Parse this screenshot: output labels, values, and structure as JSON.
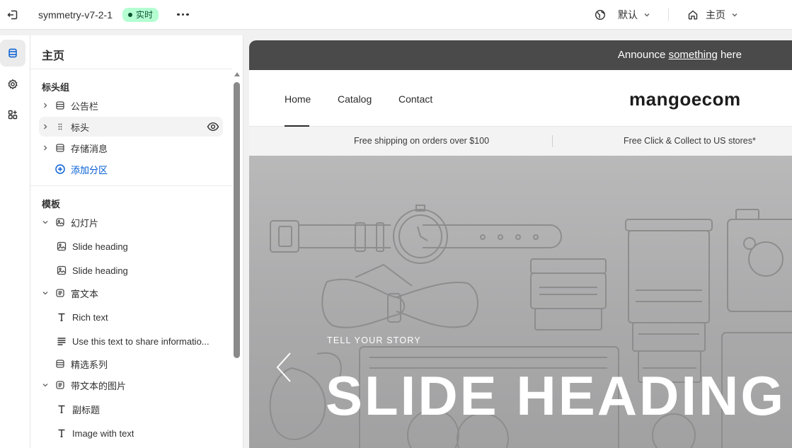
{
  "topbar": {
    "theme_name": "symmetry-v7-2-1",
    "status": "实时",
    "locale": "默认",
    "page": "主页"
  },
  "sidebar": {
    "title": "主页",
    "header_group": {
      "title": "标头组",
      "items": [
        {
          "label": "公告栏",
          "icon": "section-icon"
        },
        {
          "label": "标头",
          "icon": "drag-handle-icon"
        },
        {
          "label": "存储消息",
          "icon": "section-icon"
        }
      ],
      "add_section": "添加分区"
    },
    "template": {
      "title": "模板",
      "slideshow": {
        "label": "幻灯片",
        "blocks": [
          "Slide heading",
          "Slide heading"
        ]
      },
      "rich_text": {
        "label": "富文本",
        "blocks": [
          "Rich text",
          "Use this text to share informatio..."
        ]
      },
      "featured_collection": {
        "label": "精选系列"
      },
      "image_with_text": {
        "label": "带文本的图片",
        "blocks": [
          "副标题",
          "Image with text"
        ]
      }
    }
  },
  "preview": {
    "announcement": {
      "before": "Announce ",
      "link": "something",
      "after": " here"
    },
    "nav": [
      "Home",
      "Catalog",
      "Contact"
    ],
    "logo": "mangoecom",
    "shipping": [
      "Free shipping on orders over $100",
      "Free Click & Collect to US stores*"
    ],
    "hero": {
      "kicker": "TELL YOUR STORY",
      "heading": "SLIDE HEADING"
    }
  }
}
